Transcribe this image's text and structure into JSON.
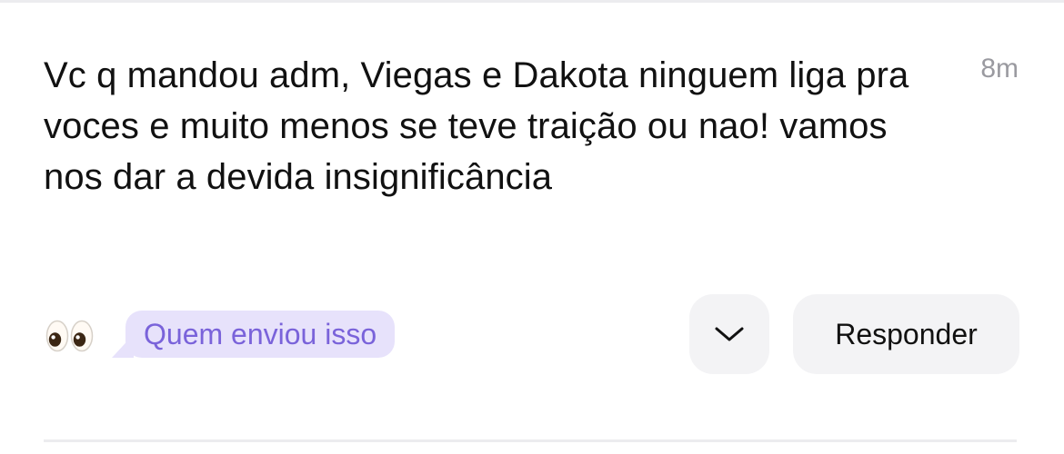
{
  "message": {
    "text": "Vc q mandou adm, Viegas e Dakota ninguem liga pra voces e muito menos se teve traição ou nao! vamos nos dar a devida insignificância",
    "timestamp": "8m"
  },
  "reactions": {
    "emoji_icon": "eyes-emoji-icon"
  },
  "prompt_bubble": {
    "label": "Quem enviou isso"
  },
  "actions": {
    "dropdown_icon": "chevron-down-icon",
    "reply_label": "Responder"
  },
  "colors": {
    "bubble_background": "#e7e2fb",
    "bubble_text": "#7a63da",
    "button_background": "#f3f3f5",
    "timestamp": "#9a9aa0"
  }
}
